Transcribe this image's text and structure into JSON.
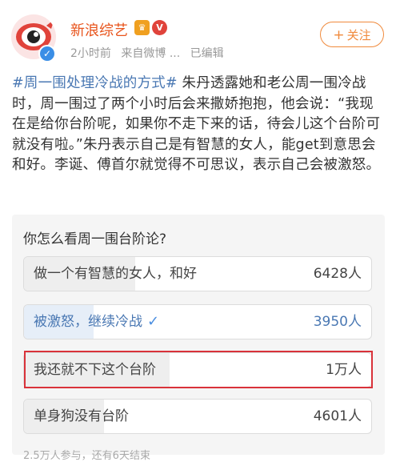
{
  "account": {
    "name": "新浪综艺",
    "badge_vip": "♛",
    "badge_hot": "V",
    "verified_mark": "✓",
    "time": "2小时前",
    "source": "来自微博 ...",
    "edited": "已编辑"
  },
  "follow_button": {
    "plus": "+",
    "label": "关注"
  },
  "post": {
    "hashtag": "#周一围处理冷战的方式#",
    "body": " 朱丹透露她和老公周一围冷战时，周一围过了两个小时后会来撒娇抱抱，他会说：“我现在是给你台阶呢，如果你不走下来的话，待会儿这个台阶可就没有啦。”朱丹表示自己是有智慧的女人，能get到意思会和好。李诞、傅首尔就觉得不可思议，表示自己会被激怒。"
  },
  "poll": {
    "question": "你怎么看周一围台阶论?",
    "options": [
      {
        "label": "做一个有智慧的女人，和好",
        "count": "6428人",
        "share": 0.32
      },
      {
        "label": "被激怒，继续冷战",
        "count": "3950人",
        "share": 0.2,
        "selected": true,
        "check": "✓"
      },
      {
        "label": "我还就不下这个台阶",
        "count": "1万人",
        "share": 0.42
      },
      {
        "label": "单身狗没有台阶",
        "count": "4601人",
        "share": 0.23
      }
    ],
    "footer": "2.5万人参与，还有6天结束"
  },
  "colors": {
    "accent": "#f08a3c",
    "link": "#4a78b3",
    "highlight": "#d9323a"
  }
}
